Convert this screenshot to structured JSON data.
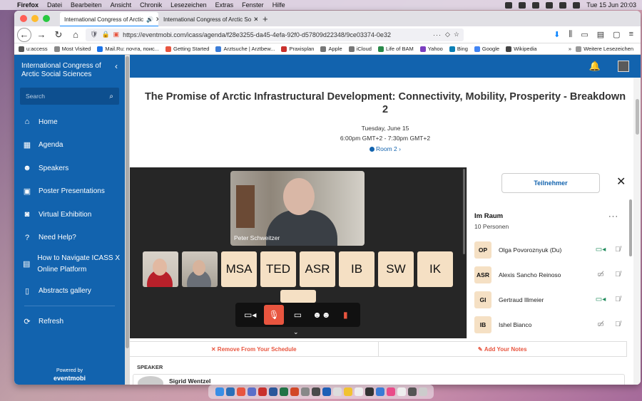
{
  "menubar": {
    "app": "Firefox",
    "items": [
      "Datei",
      "Bearbeiten",
      "Ansicht",
      "Chronik",
      "Lesezeichen",
      "Extras",
      "Fenster",
      "Hilfe"
    ],
    "datetime": "Tue 15 Jun  20:03"
  },
  "browser": {
    "tabs": [
      {
        "label": "International Congress of Arctic",
        "active": true
      },
      {
        "label": "International Congress of Arctic So",
        "active": false
      }
    ],
    "url": "https://eventmobi.com/icass/agenda/f28e3255-da45-4efa-92f0-d57809d22348/9ce03374-0e32",
    "bookmarks": [
      "u:access",
      "Most Visited",
      "Mail.Ru: почта, поис...",
      "Getting Started",
      "Arztsuche | Arztbew...",
      "Praxisplan",
      "Apple",
      "iCloud",
      "Life of BAM",
      "Yahoo",
      "Bing",
      "Google",
      "Wikipedia"
    ],
    "other_bookmarks": "Weitere Lesezeichen"
  },
  "sidebar": {
    "title": "International Congress of Arctic Social Sciences",
    "search_placeholder": "Search",
    "items": [
      {
        "label": "Home",
        "icon": "home-icon"
      },
      {
        "label": "Agenda",
        "icon": "calendar-icon"
      },
      {
        "label": "Speakers",
        "icon": "people-icon"
      },
      {
        "label": "Poster Presentations",
        "icon": "image-icon"
      },
      {
        "label": "Virtual Exhibition",
        "icon": "camera-icon"
      },
      {
        "label": "Need Help?",
        "icon": "help-icon"
      },
      {
        "label": "How to Navigate ICASS X Online Platform",
        "icon": "film-icon"
      },
      {
        "label": "Abstracts gallery",
        "icon": "document-icon"
      }
    ],
    "refresh": "Refresh",
    "powered_by": "Powered by",
    "powered_logo": "eventmobi"
  },
  "session": {
    "title": "The Promise of Arctic Infrastructural Development: Connectivity, Mobility, Prosperity - Breakdown 2",
    "date": "Tuesday, June 15",
    "time": "6:00pm GMT+2 - 7:30pm GMT+2",
    "room": "Room 2"
  },
  "video": {
    "active_speaker": "Peter Schweitzer",
    "thumbnails": [
      "MSA",
      "TED",
      "ASR",
      "IB",
      "SW",
      "IK"
    ]
  },
  "participants": {
    "tab_label": "Teilnehmer",
    "section": "Im Raum",
    "count": "10 Personen",
    "list": [
      {
        "initials": "OP",
        "name": "Olga Povoroznyuk (Du)",
        "camera": "on"
      },
      {
        "initials": "ASR",
        "name": "Alexis Sancho Reinoso",
        "camera": "off"
      },
      {
        "initials": "GI",
        "name": "Gertraud Illmeier",
        "camera": "on"
      },
      {
        "initials": "IB",
        "name": "Ishel Bianco",
        "camera": "off"
      }
    ]
  },
  "actions": {
    "remove": "✕ Remove From Your Schedule",
    "notes": "Add Your Notes"
  },
  "speaker_section": {
    "label": "SPEAKER",
    "name": "Sigrid Wentzel"
  }
}
